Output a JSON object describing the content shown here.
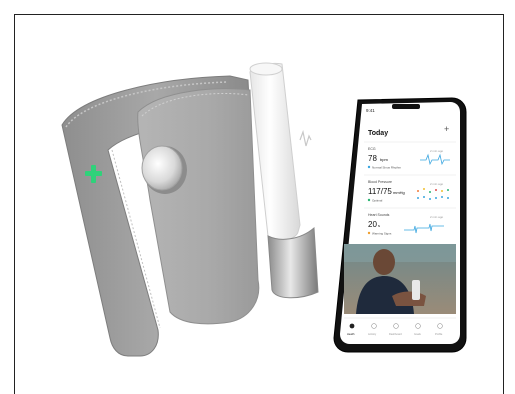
{
  "product_photo": {
    "phone": {
      "status_time": "9:41",
      "screen_title": "Today",
      "add_symbol": "+",
      "cards": [
        {
          "title": "ECG",
          "value": "78",
          "unit": "bpm",
          "tag": "Normal Sinus Rhythm",
          "time": "2 min ago",
          "accent": "#3aa6e0"
        },
        {
          "title": "Blood Pressure",
          "value": "117/75",
          "unit": "mmHg",
          "tag": "Optimal",
          "time": "2 min ago",
          "accent": "#2bb673"
        },
        {
          "title": "Heart Sounds",
          "value": "20",
          "unit": "s",
          "tag": "Warning Signs",
          "time": "2 min ago",
          "accent": "#f0a030"
        }
      ],
      "tabs": [
        "Health",
        "Activity",
        "Dashboard",
        "Goals",
        "Profile"
      ]
    },
    "colors": {
      "cuff": "#9a9a9a",
      "cuff_light": "#b4b4b4",
      "cross": "#2fd27a",
      "device": "#f2f2f2"
    }
  }
}
